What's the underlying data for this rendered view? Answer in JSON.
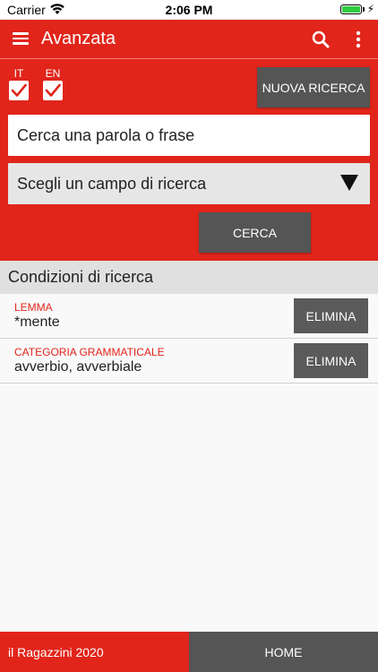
{
  "status_bar": {
    "carrier": "Carrier",
    "time": "2:06 PM",
    "battery_level": 1.0,
    "battery_color": "#2ecc40"
  },
  "app_bar": {
    "title": "Avanzata",
    "menu_icon": "hamburger-icon",
    "search_icon": "search-icon",
    "more_icon": "more-vertical-icon"
  },
  "languages": [
    {
      "label": "IT",
      "checked": true
    },
    {
      "label": "EN",
      "checked": true
    }
  ],
  "search": {
    "new_search_label": "NUOVA RICERCA",
    "input_placeholder": "Cerca una parola o frase",
    "input_value": "",
    "field_select_value": "Scegli un campo di ricerca",
    "search_button_label": "CERCA"
  },
  "conditions": {
    "header": "Condizioni di ricerca",
    "items": [
      {
        "field": "LEMMA",
        "value": "*mente",
        "delete_label": "ELIMINA"
      },
      {
        "field": "CATEGORIA GRAMMATICALE",
        "value": "avverbio, avverbiale",
        "delete_label": "ELIMINA"
      }
    ]
  },
  "footer": {
    "brand": "il Ragazzini 2020",
    "home_label": "HOME"
  },
  "colors": {
    "accent": "#e1251b",
    "dark_button": "#555555"
  }
}
